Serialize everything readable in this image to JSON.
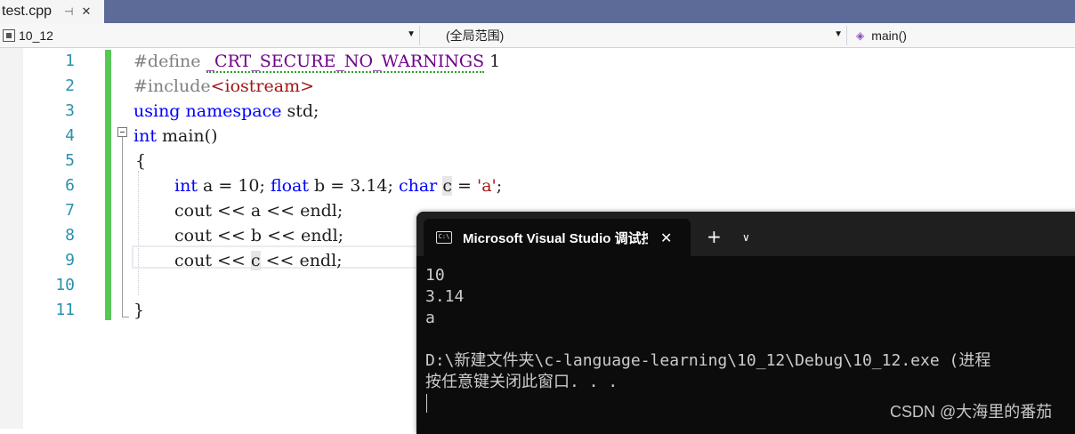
{
  "tab": {
    "filename": "test.cpp",
    "pin_glyph": "⊣",
    "close_glyph": "✕"
  },
  "navbar": {
    "project": "10_12",
    "scope": "(全局范围)",
    "member": "main()"
  },
  "editor": {
    "line_numbers": [
      "1",
      "2",
      "3",
      "4",
      "5",
      "6",
      "7",
      "8",
      "9",
      "10",
      "11"
    ],
    "code": {
      "l1": {
        "directive": "#define ",
        "macro": "_CRT_SECURE_NO_WARNINGS",
        "rest": " 1"
      },
      "l2": {
        "directive": "#include",
        "header": "<iostream>"
      },
      "l3": {
        "kw1": "using",
        "sp": " ",
        "kw2": "namespace",
        "rest": " std;"
      },
      "l4": {
        "kw": "int",
        "rest": " main()"
      },
      "l5": {
        "text": "{"
      },
      "l6": {
        "kw_int": "int",
        "p1": " a = 10; ",
        "kw_float": "float",
        "p2": " b = 3.14; ",
        "kw_char": "char",
        "p3": " ",
        "var_c": "c",
        "p4": " = ",
        "char_lit": "'a'",
        "p5": ";"
      },
      "l7": {
        "text": "cout << a << endl;"
      },
      "l8": {
        "text": "cout << b << endl;"
      },
      "l9": {
        "pre": "cout << ",
        "var_c": "c",
        "post": " << endl;"
      },
      "l10": {
        "text": ""
      },
      "l11": {
        "text": "}"
      }
    }
  },
  "console": {
    "title": "Microsoft Visual Studio 调试控制台",
    "icon_text": "C:\\",
    "close_glyph": "✕",
    "new_tab_glyph": "+",
    "dropdown_glyph": "∨",
    "output": [
      "10",
      "3.14",
      "a",
      "",
      "D:\\新建文件夹\\c-language-learning\\10_12\\Debug\\10_12.exe (进程",
      "按任意键关闭此窗口. . ."
    ]
  },
  "watermark": "CSDN @大海里的番茄"
}
